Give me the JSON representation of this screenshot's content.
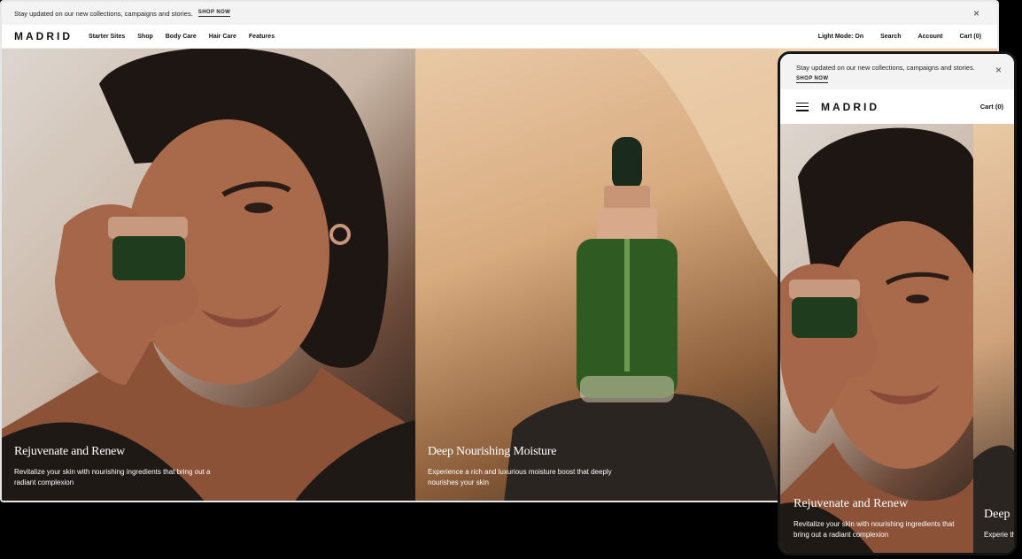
{
  "desktop": {
    "announcement": {
      "text": "Stay updated on our new collections, campaigns and stories.",
      "cta": "SHOP NOW",
      "close": "×"
    },
    "nav": {
      "logo": "MADRID",
      "menu": [
        "Starter Sites",
        "Shop",
        "Body Care",
        "Hair Care",
        "Features"
      ],
      "light_mode": "Light Mode: On",
      "search": "Search",
      "account": "Account",
      "cart": "Cart (0)"
    },
    "slides": [
      {
        "title": "Rejuvenate and Renew",
        "text": "Revitalize your skin with nourishing ingredients that bring out a radiant complexion"
      },
      {
        "title": "Deep Nourishing Moisture",
        "text": "Experience a rich and luxurious moisture boost that deeply nourishes your skin"
      }
    ]
  },
  "mobile": {
    "announcement": {
      "text": "Stay updated on our new collections, campaigns and stories.",
      "cta": "SHOP NOW",
      "close": "×"
    },
    "nav": {
      "menu_icon": "hamburger-icon",
      "logo": "MADRID",
      "cart": "Cart (0)"
    },
    "slides": [
      {
        "title": "Rejuvenate and Renew",
        "text": "Revitalize your skin with nourishing ingredients that bring out a radiant complexion"
      },
      {
        "title": "Deep",
        "text": "Experie that de"
      }
    ]
  }
}
